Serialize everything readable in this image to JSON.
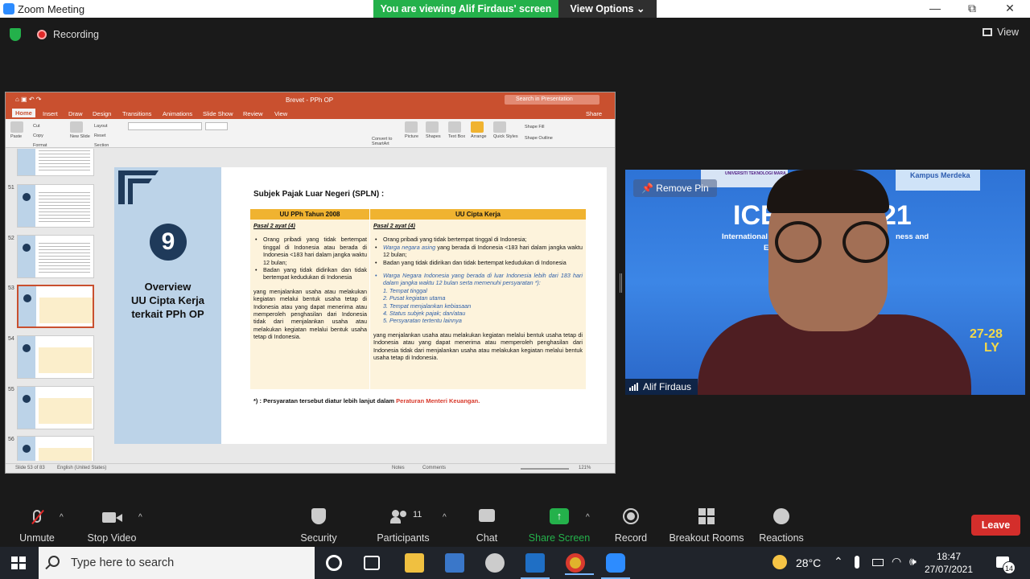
{
  "window": {
    "app_title": "Zoom Meeting",
    "viewing_banner": "You are viewing Alif Firdaus' screen",
    "view_options": "View Options ⌄",
    "minimize": "—",
    "restore": "⧉",
    "close": "✕"
  },
  "topbar": {
    "recording": "Recording",
    "view": "View"
  },
  "ppt": {
    "doc_title": "Brevet - PPh OP",
    "search_placeholder": "Search in Presentation",
    "tabs": [
      "Home",
      "Insert",
      "Draw",
      "Design",
      "Transitions",
      "Animations",
      "Slide Show",
      "Review",
      "View"
    ],
    "share": "Share",
    "ribbon": {
      "paste": "Paste",
      "cut": "Cut",
      "copy": "Copy",
      "format": "Format",
      "new_slide": "New Slide",
      "layout": "Layout",
      "reset": "Reset",
      "section": "Section",
      "convert": "Convert to SmartArt",
      "picture": "Picture",
      "shapes": "Shapes",
      "text_box": "Text Box",
      "arrange": "Arrange",
      "quick_styles": "Quick Styles",
      "shape_fill": "Shape Fill",
      "shape_outline": "Shape Outline"
    },
    "thumb_numbers": [
      "51",
      "52",
      "53",
      "54",
      "55",
      "56"
    ],
    "status": {
      "slide": "Slide 53 of 83",
      "lang": "English (United States)",
      "notes": "Notes",
      "comments": "Comments",
      "zoom": "121%"
    }
  },
  "slide": {
    "number": "9",
    "overview_l1": "Overview",
    "overview_l2": "UU Cipta Kerja",
    "overview_l3": "terkait PPh OP",
    "heading": "Subjek Pajak Luar Negeri (SPLN) :",
    "col1_header": "UU PPh Tahun 2008",
    "col2_header": "UU Cipta Kerja",
    "col1_pasal": "Pasal 2 ayat (4)",
    "col2_pasal": "Pasal 2 ayat (4)",
    "col1_b1": "Orang pribadi yang tidak bertempat tinggal di Indonesia atau berada di Indonesia <183 hari dalam jangka waktu 12 bulan;",
    "col1_b2": "Badan yang tidak didirikan dan tidak bertempat kedudukan di Indonesia",
    "col1_para": "yang menjalankan usaha atau melakukan kegiatan melalui bentuk usaha tetap di Indonesia atau yang dapat menerima atau memperoleh penghasilan dari Indonesia tidak dari menjalankan usaha atau melakukan kegiatan melalui bentuk usaha tetap di Indonesia.",
    "col2_b1": "Orang pribadi yang tidak bertempat tinggal di Indonesia;",
    "col2_b2": "Warga negara asing yang berada di Indonesia <183 hari dalam jangka waktu 12 bulan;",
    "col2_b2_italic": "Warga negara asing",
    "col2_b2_rest": " yang berada di Indonesia <183 hari dalam jangka waktu 12 bulan;",
    "col2_b3": "Badan yang tidak didirikan dan tidak bertempat kedudukan di Indonesia",
    "col2_b4": "Warga Negara Indonesia yang berada di luar Indonesia lebih dari 183 hari dalam jangka waktu 12 bulan serta memenuhi persyaratan *):",
    "col2_list": [
      "1.  Tempat tinggal",
      "2.  Pusat kegiatan utama",
      "3.  Tempat menjalankan kebiasaan",
      "4.  Status subjek pajak; dan/atau",
      "5.  Persyaratan tertentu lainnya"
    ],
    "col2_para": "yang menjalankan usaha atau melakukan kegiatan melalui bentuk usaha tetap di Indonesia atau yang dapat menerima atau memperoleh penghasilan dari Indonesia tidak dari menjalankan usaha atau melakukan kegiatan melalui bentuk usaha tetap di Indonesia.",
    "footnote": "*) : Persyaratan tersebut diatur lebih lanjut dalam ",
    "footnote_red": "Peraturan Menteri Keuangan."
  },
  "speaker": {
    "remove_pin": "Remove Pin",
    "name": "Alif Firdaus",
    "bg_ice": "ICE",
    "bg_21": "21",
    "bg_intl": "International",
    "bg_intl2": "ness and",
    "bg_ec": "Ec",
    "bg_date1": "27-28",
    "bg_date2": "LY",
    "bg_uitm": "UNIVERSITI TEKNOLOGI MARA",
    "bg_kampus": "Kampus Merdeka"
  },
  "toolbar": {
    "unmute": "Unmute",
    "stop_video": "Stop Video",
    "security": "Security",
    "participants": "Participants",
    "participants_count": "11",
    "chat": "Chat",
    "share_screen": "Share Screen",
    "record": "Record",
    "breakout": "Breakout Rooms",
    "reactions": "Reactions",
    "leave": "Leave"
  },
  "taskbar": {
    "search_placeholder": "Type here to search",
    "temperature": "28°C",
    "time": "18:47",
    "date": "27/07/2021",
    "notifications": "14"
  },
  "colors": {
    "zoom_green": "#24b14b",
    "ppt_orange": "#c9502f",
    "table_header": "#f0b330",
    "leave_red": "#d42e2b"
  }
}
